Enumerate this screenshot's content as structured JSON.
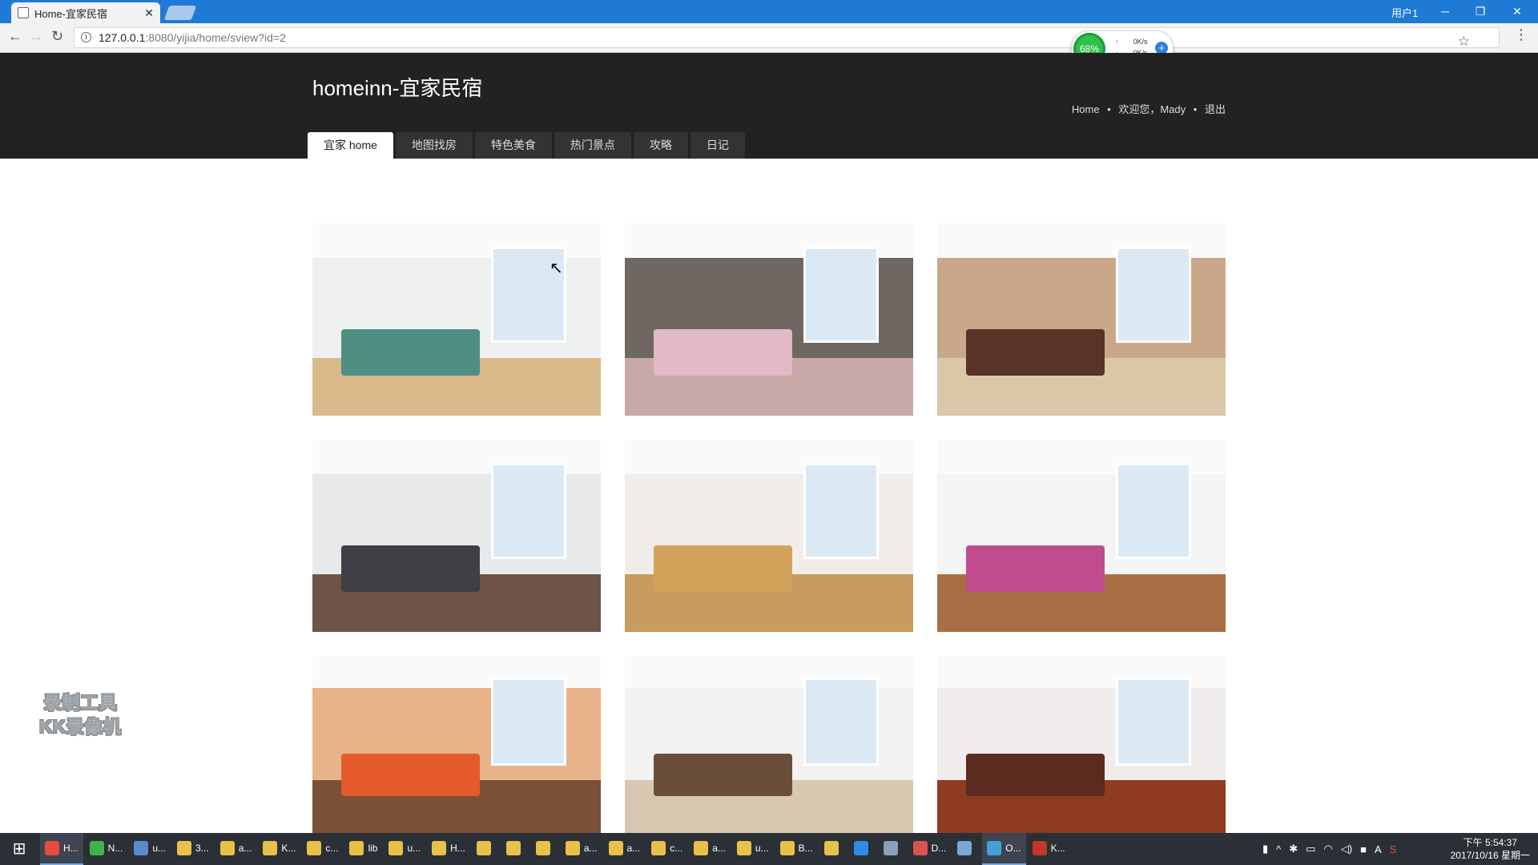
{
  "browser": {
    "tab_title": "Home-宜家民宿",
    "user_label": "用户1",
    "url_host": "127.0.0.1",
    "url_path": ":8080/yijia/home/sview?id=2"
  },
  "speed_widget": {
    "percent": "68%",
    "up": "0K/s",
    "down": "0K/s"
  },
  "site": {
    "title": "homeinn-宜家民宿",
    "links": {
      "home": "Home",
      "welcome": "欢迎您，Mady",
      "logout": "退出"
    },
    "nav": [
      "宜家 home",
      "地图找房",
      "特色美食",
      "热门景点",
      "攻略",
      "日记"
    ],
    "active_nav": 0
  },
  "gallery": {
    "photos": [
      {
        "name": "bedroom-white",
        "wall": "#eef0f0",
        "floor": "#d9b98a",
        "accent": "#4f8f82"
      },
      {
        "name": "bedroom-pink",
        "wall": "#6f6862",
        "floor": "#c9a9a8",
        "accent": "#e2b9c6"
      },
      {
        "name": "living-brown",
        "wall": "#c9a88a",
        "floor": "#d9c7a8",
        "accent": "#5a3328"
      },
      {
        "name": "living-gray-sofa",
        "wall": "#e7e9ea",
        "floor": "#6e5446",
        "accent": "#3e3f44"
      },
      {
        "name": "stairs-living",
        "wall": "#f1eee9",
        "floor": "#c89b5e",
        "accent": "#d2a35a"
      },
      {
        "name": "living-tree-decal",
        "wall": "#f4f4f4",
        "floor": "#a86f45",
        "accent": "#c04c8e"
      },
      {
        "name": "dining-orange",
        "wall": "#e8b38a",
        "floor": "#7a5038",
        "accent": "#e55a2b"
      },
      {
        "name": "dining-white",
        "wall": "#f2f2f0",
        "floor": "#d8c8b2",
        "accent": "#6b4e3a"
      },
      {
        "name": "living-redwood",
        "wall": "#efeceb",
        "floor": "#8e3b22",
        "accent": "#5c2a1e"
      }
    ]
  },
  "watermark": {
    "line1": "录制工具",
    "line2": "KK录像机"
  },
  "taskbar": {
    "items": [
      {
        "label": "H...",
        "color": "#e74c3c",
        "active": true
      },
      {
        "label": "N...",
        "color": "#3fb44a",
        "active": false
      },
      {
        "label": "u...",
        "color": "#5b8bc9",
        "active": false
      },
      {
        "label": "3...",
        "color": "#e8c14a",
        "active": false
      },
      {
        "label": "a...",
        "color": "#e8c14a",
        "active": false
      },
      {
        "label": "K...",
        "color": "#e8c14a",
        "active": false
      },
      {
        "label": "c...",
        "color": "#e8c14a",
        "active": false
      },
      {
        "label": "lib",
        "color": "#e8c14a",
        "active": false
      },
      {
        "label": "u...",
        "color": "#e8c14a",
        "active": false
      },
      {
        "label": "H...",
        "color": "#e8c14a",
        "active": false
      },
      {
        "label": "",
        "color": "#e8c14a",
        "active": false
      },
      {
        "label": "",
        "color": "#e8c14a",
        "active": false
      },
      {
        "label": "",
        "color": "#e8c14a",
        "active": false
      },
      {
        "label": "a...",
        "color": "#e8c14a",
        "active": false
      },
      {
        "label": "a...",
        "color": "#e8c14a",
        "active": false
      },
      {
        "label": "c...",
        "color": "#e8c14a",
        "active": false
      },
      {
        "label": "a...",
        "color": "#e8c14a",
        "active": false
      },
      {
        "label": "u...",
        "color": "#e8c14a",
        "active": false
      },
      {
        "label": "B...",
        "color": "#e8c14a",
        "active": false
      },
      {
        "label": "",
        "color": "#e8c14a",
        "active": false
      },
      {
        "label": "",
        "color": "#2e8be6",
        "active": false
      },
      {
        "label": "",
        "color": "#8aa0b8",
        "active": false
      },
      {
        "label": "D...",
        "color": "#d9534f",
        "active": false
      },
      {
        "label": "",
        "color": "#7aa6d8",
        "active": false
      },
      {
        "label": "O...",
        "color": "#46a0d8",
        "active": true
      },
      {
        "label": "K...",
        "color": "#c0392b",
        "active": false
      }
    ],
    "clock_time": "下午 5:54:37",
    "clock_date": "2017/10/16 星期一",
    "ime": "A"
  }
}
